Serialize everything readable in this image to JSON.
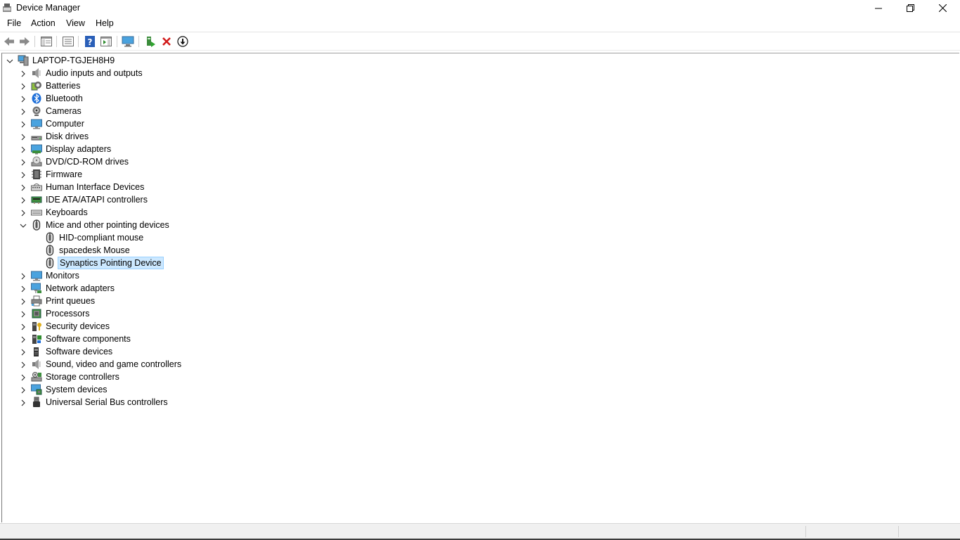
{
  "window": {
    "title": "Device Manager",
    "controls": {
      "minimize": "minimize",
      "restore": "restore",
      "close": "close"
    }
  },
  "menu": [
    "File",
    "Action",
    "View",
    "Help"
  ],
  "toolbar": [
    "back-arrow",
    "forward-arrow",
    "show-hide-console-tree",
    "properties",
    "help",
    "action-pane",
    "scan-for-hardware-changes",
    "update-driver",
    "uninstall-device",
    "disable-device"
  ],
  "tree": {
    "root": "LAPTOP-TGJEH8H9",
    "categories": [
      {
        "label": "Audio inputs and outputs",
        "icon": "speaker-icon",
        "expanded": false
      },
      {
        "label": "Batteries",
        "icon": "battery-icon",
        "expanded": false
      },
      {
        "label": "Bluetooth",
        "icon": "bluetooth-icon",
        "expanded": false
      },
      {
        "label": "Cameras",
        "icon": "camera-icon",
        "expanded": false
      },
      {
        "label": "Computer",
        "icon": "monitor-icon",
        "expanded": false
      },
      {
        "label": "Disk drives",
        "icon": "disk-icon",
        "expanded": false
      },
      {
        "label": "Display adapters",
        "icon": "display-adapter-icon",
        "expanded": false
      },
      {
        "label": "DVD/CD-ROM drives",
        "icon": "dvd-icon",
        "expanded": false
      },
      {
        "label": "Firmware",
        "icon": "chip-icon",
        "expanded": false
      },
      {
        "label": "Human Interface Devices",
        "icon": "hid-icon",
        "expanded": false
      },
      {
        "label": "IDE ATA/ATAPI controllers",
        "icon": "ide-icon",
        "expanded": false
      },
      {
        "label": "Keyboards",
        "icon": "keyboard-icon",
        "expanded": false
      },
      {
        "label": "Mice and other pointing devices",
        "icon": "mouse-icon",
        "expanded": true,
        "children": [
          {
            "label": "HID-compliant mouse",
            "icon": "mouse-icon",
            "selected": false
          },
          {
            "label": "spacedesk Mouse",
            "icon": "mouse-icon",
            "selected": false
          },
          {
            "label": "Synaptics Pointing Device",
            "icon": "mouse-icon",
            "selected": true
          }
        ]
      },
      {
        "label": "Monitors",
        "icon": "monitor-icon",
        "expanded": false
      },
      {
        "label": "Network adapters",
        "icon": "network-icon",
        "expanded": false
      },
      {
        "label": "Print queues",
        "icon": "printer-icon",
        "expanded": false
      },
      {
        "label": "Processors",
        "icon": "processor-icon",
        "expanded": false
      },
      {
        "label": "Security devices",
        "icon": "security-icon",
        "expanded": false
      },
      {
        "label": "Software components",
        "icon": "software-component-icon",
        "expanded": false
      },
      {
        "label": "Software devices",
        "icon": "software-device-icon",
        "expanded": false
      },
      {
        "label": "Sound, video and game controllers",
        "icon": "speaker-icon",
        "expanded": false
      },
      {
        "label": "Storage controllers",
        "icon": "storage-icon",
        "expanded": false
      },
      {
        "label": "System devices",
        "icon": "system-icon",
        "expanded": false
      },
      {
        "label": "Universal Serial Bus controllers",
        "icon": "usb-icon",
        "expanded": false
      }
    ]
  },
  "colors": {
    "selection": "#cce8ff",
    "selection_border": "#99d1ff",
    "accent": "#1e90ff"
  }
}
